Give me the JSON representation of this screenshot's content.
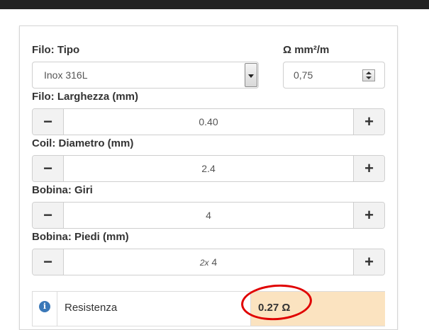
{
  "wire_type": {
    "label": "Filo: Tipo",
    "selected": "Inox 316L"
  },
  "resistivity": {
    "label": "Ω mm²/m",
    "value": "0,75"
  },
  "wire_width": {
    "label": "Filo: Larghezza (mm)",
    "value": "0.40",
    "minus": "−",
    "plus": "+"
  },
  "coil_diameter": {
    "label": "Coil: Diametro (mm)",
    "value": "2.4",
    "minus": "−",
    "plus": "+"
  },
  "turns": {
    "label": "Bobina: Giri",
    "value": "4",
    "minus": "−",
    "plus": "+"
  },
  "legs": {
    "label": "Bobina: Piedi (mm)",
    "prefix": "2x",
    "value": "4",
    "minus": "−",
    "plus": "+"
  },
  "result": {
    "info_icon": "i",
    "label": "Resistenza",
    "value": "0.27 Ω"
  },
  "colors": {
    "highlight": "#fbe3c0",
    "annotation": "#e00000",
    "info": "#3a78b8"
  }
}
